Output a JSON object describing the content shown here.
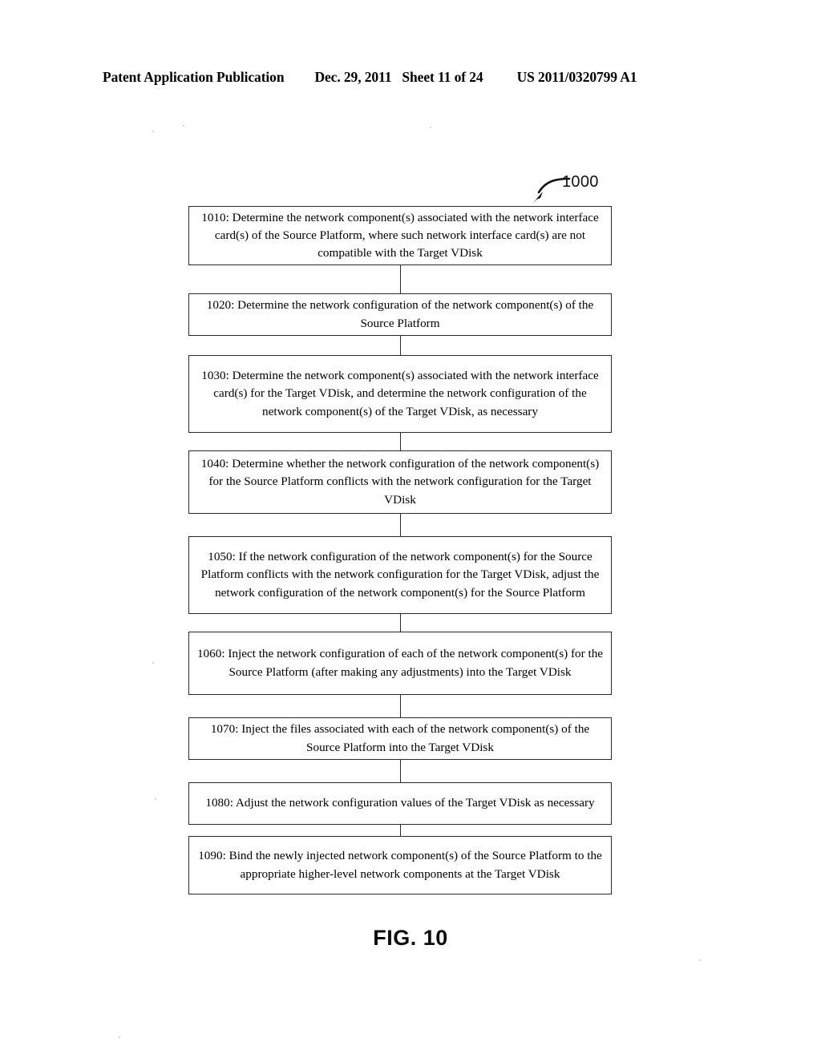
{
  "header": {
    "publication": "Patent Application Publication",
    "date": "Dec. 29, 2011",
    "sheet": "Sheet 11 of 24",
    "patent_number": "US 2011/0320799 A1"
  },
  "figure": {
    "reference_label": "1000",
    "caption": "FIG. 10",
    "arrow_icon": "curved-arrow-icon",
    "steps": [
      {
        "id": "1010",
        "text": "1010: Determine the network component(s) associated with the network interface card(s) of the Source Platform, where such network interface card(s) are not compatible with the Target VDisk"
      },
      {
        "id": "1020",
        "text": "1020: Determine the network configuration of the network component(s) of the Source Platform"
      },
      {
        "id": "1030",
        "text": "1030: Determine the network component(s) associated with the network interface card(s) for the Target VDisk, and determine the network configuration of the network component(s) of the Target VDisk, as necessary"
      },
      {
        "id": "1040",
        "text": "1040: Determine whether the network configuration of the network component(s) for the Source Platform conflicts with the network configuration for the Target VDisk"
      },
      {
        "id": "1050",
        "text": "1050: If the network configuration of the network component(s) for the Source Platform conflicts with the network configuration for the Target VDisk, adjust the network configuration of the network component(s) for the Source Platform"
      },
      {
        "id": "1060",
        "text": "1060: Inject the network configuration of each of the network component(s) for the Source Platform (after making any adjustments) into the Target VDisk"
      },
      {
        "id": "1070",
        "text": "1070: Inject the files associated with each of the network component(s) of the Source Platform into the Target VDisk"
      },
      {
        "id": "1080",
        "text": "1080: Adjust the network configuration values of the Target VDisk as necessary"
      },
      {
        "id": "1090",
        "text": "1090: Bind the newly injected network component(s) of the Source Platform to the appropriate higher-level network components at the Target VDisk"
      }
    ]
  },
  "colors": {
    "ink": "#000000",
    "line": "#2b2b2b",
    "page": "#ffffff"
  }
}
